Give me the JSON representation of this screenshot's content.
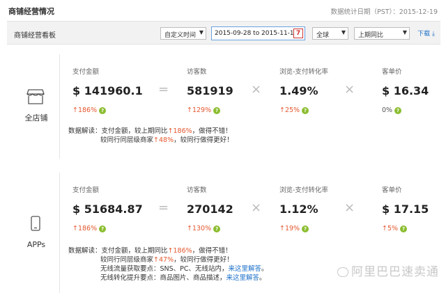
{
  "header": {
    "title": "商铺经营情况",
    "stat_date": "数据统计日期（PST）：2015-12-19"
  },
  "toolbar": {
    "board_title": "商铺经营看板",
    "time_select": "自定义时间",
    "date_range": "2015-09-28 to 2015-11-12",
    "calendar_day": "7",
    "region_select": "全球",
    "compare_select": "上期同比",
    "download_label": "下载"
  },
  "panels": [
    {
      "label": "全店铺",
      "metrics": [
        {
          "label": "支付金额",
          "value": "$ 141960.1",
          "change": "↑186%"
        },
        {
          "label": "访客数",
          "value": "581919",
          "change": "↑129%"
        },
        {
          "label": "浏览-支付转化率",
          "value": "1.49%",
          "change": "↑25%"
        },
        {
          "label": "客单价",
          "value": "$ 16.34",
          "change": "0%"
        }
      ],
      "ops": [
        "=",
        "×",
        "×"
      ],
      "insight": {
        "l1_prefix": "数据解读：支付金额，较上期同比",
        "l1_hl": "↑186%",
        "l1_suffix": "，做得不错！",
        "l2_prefix": "较同行同层级商家",
        "l2_hl": "↑48%",
        "l2_suffix": "，较同行做得更好！"
      }
    },
    {
      "label": "APPs",
      "metrics": [
        {
          "label": "支付金额",
          "value": "$ 51684.87",
          "change": "↑186%"
        },
        {
          "label": "访客数",
          "value": "270142",
          "change": "↑130%"
        },
        {
          "label": "浏览-支付转化率",
          "value": "1.12%",
          "change": "↑19%"
        },
        {
          "label": "客单价",
          "value": "$ 17.15",
          "change": "↑5%"
        }
      ],
      "ops": [
        "=",
        "×",
        "×"
      ],
      "insight": {
        "l1_prefix": "数据解读：支付金额，较上期同比",
        "l1_hl": "↑186%",
        "l1_suffix": "，做得不错！",
        "l2_prefix": "较同行同层级商家",
        "l2_hl": "↑47%",
        "l2_suffix": "，较同行做得更好！",
        "l3_prefix": "无线流量获取要点：SNS、PC、无线站内，",
        "l3_link": "来这里解答",
        "l3_suffix": "。",
        "l4_prefix": "无线转化提升要点：商品图片、商品描述，",
        "l4_link": "来这里解答",
        "l4_suffix": "。"
      }
    }
  ],
  "watermark": "阿里巴巴速卖通",
  "colors": {
    "up": "#e4572e",
    "help": "#8bbd2f",
    "link": "#1a6fc9",
    "accent_border": "#6aa2e0"
  },
  "icons": [
    "store-icon",
    "phone-icon",
    "calendar-icon",
    "download-icon",
    "help-icon",
    "chevron-down-icon",
    "wechat-icon"
  ]
}
